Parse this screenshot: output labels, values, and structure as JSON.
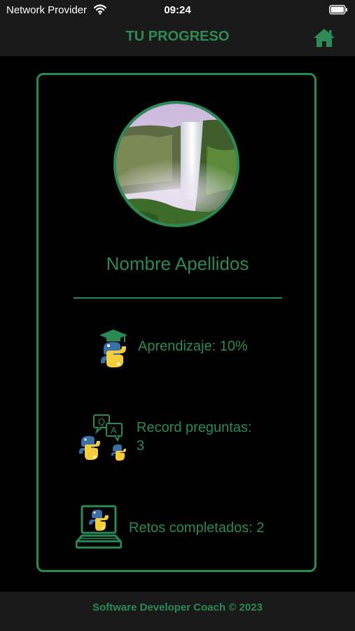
{
  "status_bar": {
    "carrier": "Network Provider",
    "time": "09:24",
    "wifi_icon": "wifi-icon",
    "battery_icon": "battery-icon"
  },
  "nav": {
    "title": "TU PROGRESO",
    "home_icon": "home-icon"
  },
  "profile": {
    "avatar_icon": "waterfall-photo",
    "name": "Nombre Apellidos"
  },
  "stats": {
    "learning": {
      "icon": "python-graduate-icon",
      "text": "Aprendizaje: 10%"
    },
    "quiz_record": {
      "icon": "python-qa-icon",
      "line1": "Record preguntas:",
      "line2": "3"
    },
    "challenges": {
      "icon": "python-laptop-icon",
      "text": "Retos completados: 2"
    }
  },
  "footer": {
    "text": "Software Developer Coach © 2023"
  },
  "colors": {
    "accent": "#2a8a55",
    "bar_background": "#1a1a1a",
    "background": "#000000"
  }
}
